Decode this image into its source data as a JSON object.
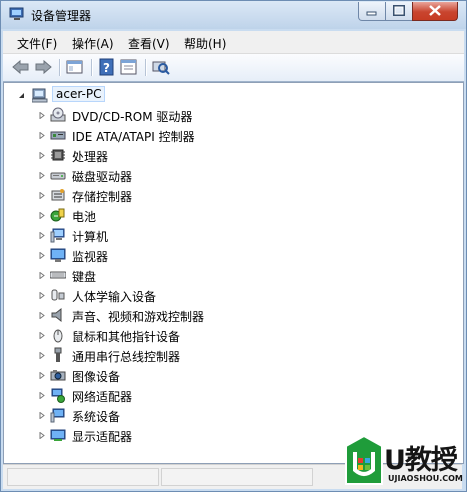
{
  "window": {
    "title": "设备管理器"
  },
  "menu": [
    "文件(F)",
    "操作(A)",
    "查看(V)",
    "帮助(H)"
  ],
  "toolbar": {
    "icons": [
      "back-arrow-icon",
      "forward-arrow-icon",
      "show-hide-console-tree-icon",
      "help-icon",
      "properties-icon",
      "scan-hardware-icon"
    ]
  },
  "tree": {
    "root": "acer-PC",
    "items": [
      {
        "label": "DVD/CD-ROM 驱动器",
        "icon": "dvd-drive-icon"
      },
      {
        "label": "IDE ATA/ATAPI 控制器",
        "icon": "ide-controller-icon"
      },
      {
        "label": "处理器",
        "icon": "processor-icon"
      },
      {
        "label": "磁盘驱动器",
        "icon": "disk-drive-icon"
      },
      {
        "label": "存储控制器",
        "icon": "storage-controller-icon"
      },
      {
        "label": "电池",
        "icon": "battery-icon"
      },
      {
        "label": "计算机",
        "icon": "computer-icon"
      },
      {
        "label": "监视器",
        "icon": "monitor-icon"
      },
      {
        "label": "键盘",
        "icon": "keyboard-icon"
      },
      {
        "label": "人体学输入设备",
        "icon": "hid-icon"
      },
      {
        "label": "声音、视频和游戏控制器",
        "icon": "sound-icon"
      },
      {
        "label": "鼠标和其他指针设备",
        "icon": "mouse-icon"
      },
      {
        "label": "通用串行总线控制器",
        "icon": "usb-icon"
      },
      {
        "label": "图像设备",
        "icon": "imaging-icon"
      },
      {
        "label": "网络适配器",
        "icon": "network-adapter-icon"
      },
      {
        "label": "系统设备",
        "icon": "system-device-icon"
      },
      {
        "label": "显示适配器",
        "icon": "display-adapter-icon"
      }
    ]
  },
  "watermark": {
    "text": "U教授",
    "sub": "UJIAOSHOU.COM"
  }
}
